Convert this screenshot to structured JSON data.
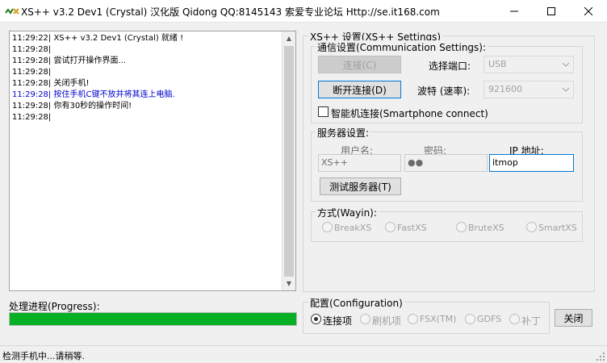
{
  "window": {
    "title": "XS++ v3.2 Dev1 (Crystal) 汉化版 Qidong QQ:8145143 索爱专业论坛 Http://se.it168.com"
  },
  "log": {
    "lines": [
      {
        "text": "11:29:22| XS++ v3.2 Dev1 (Crystal) 就绪 !",
        "color": "black"
      },
      {
        "text": "11:29:28|",
        "color": "black"
      },
      {
        "text": "11:29:28| 尝试打开操作界面...",
        "color": "black"
      },
      {
        "text": "11:29:28|",
        "color": "black"
      },
      {
        "text": "11:29:28| 关闭手机!",
        "color": "black"
      },
      {
        "text": "11:29:28| 按住手机C键不放并将其连上电脑.",
        "color": "#0000cc"
      },
      {
        "text": "11:29:28| 你有30秒的操作时间!",
        "color": "black"
      },
      {
        "text": "11:29:28|",
        "color": "black"
      }
    ]
  },
  "settings": {
    "title": "XS++ 设置(XS++ Settings)",
    "comm": {
      "title": "通信设置(Communication Settings):",
      "connect_label": "连接(C)",
      "disconnect_label": "断开连接(D)",
      "port_label": "选择端口:",
      "port_value": "USB",
      "baud_label": "波特 (速率):",
      "baud_value": "921600",
      "smartphone_label": "智能机连接(Smartphone connect)",
      "smartphone_checked": false
    },
    "server": {
      "title": "服务器设置:",
      "username_label": "用户名:",
      "username_value": "XS++",
      "password_label": "密码:",
      "password_value": "●●",
      "ip_label": "IP 地址:",
      "ip_value": "itmop",
      "test_label": "测试服务器(T)"
    },
    "mode": {
      "title": "方式(Wayin):",
      "options": [
        "BreakXS",
        "FastXS",
        "BruteXS",
        "SmartXS"
      ]
    }
  },
  "progress": {
    "label": "处理进程(Progress):",
    "fraction": 1.0,
    "color": "#06b025"
  },
  "config": {
    "title": "配置(Configuration)",
    "options": [
      "连接项",
      "刷机项",
      "FSX(TM)",
      "GDFS",
      "补丁"
    ],
    "selected": 0
  },
  "close_label": "关闭",
  "status": {
    "text": "检测手机中...请稍等."
  }
}
